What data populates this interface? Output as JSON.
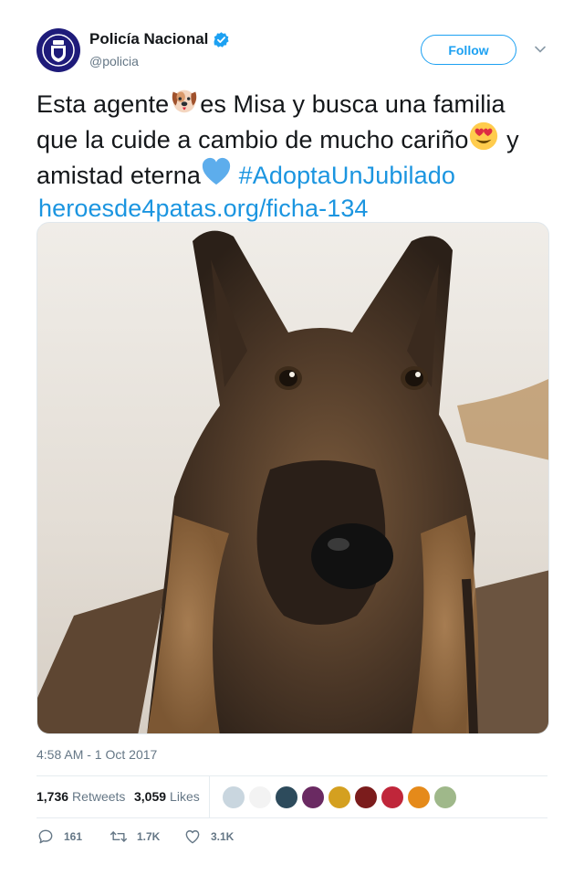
{
  "author": {
    "display_name": "Policía Nacional",
    "handle": "@policia",
    "verified": true,
    "avatar_color": "#1e1b7a"
  },
  "follow_button": {
    "label": "Follow",
    "color": "#1da1f2"
  },
  "tweet": {
    "line1_a": "Esta agente",
    "line1_b": "es Misa y busca una familia",
    "line2_a": "que la cuide a cambio de mucho cariño",
    "line2_b": " y",
    "line3_a": "amistad eterna",
    "hashtag": "#AdoptaUnJubilado",
    "link": "heroesde4patas.org/ficha-134",
    "emojis": [
      "dog-face",
      "heart-eyes",
      "blue-heart"
    ],
    "link_color": "#1b95e0"
  },
  "timestamp": "4:58 AM - 1 Oct 2017",
  "stats": {
    "retweets_count": "1,736",
    "retweets_label": "Retweets",
    "likes_count": "3,059",
    "likes_label": "Likes"
  },
  "likers": [
    {
      "color": "#c9d6df"
    },
    {
      "color": "#f3f3f3"
    },
    {
      "color": "#2d4b5c"
    },
    {
      "color": "#6a2a62"
    },
    {
      "color": "#d4a020"
    },
    {
      "color": "#7b1c1c"
    },
    {
      "color": "#c0263a"
    },
    {
      "color": "#e58a1a"
    },
    {
      "color": "#9fb88a"
    }
  ],
  "actions": {
    "reply_count": "161",
    "retweet_count": "1.7K",
    "like_count": "3.1K"
  }
}
